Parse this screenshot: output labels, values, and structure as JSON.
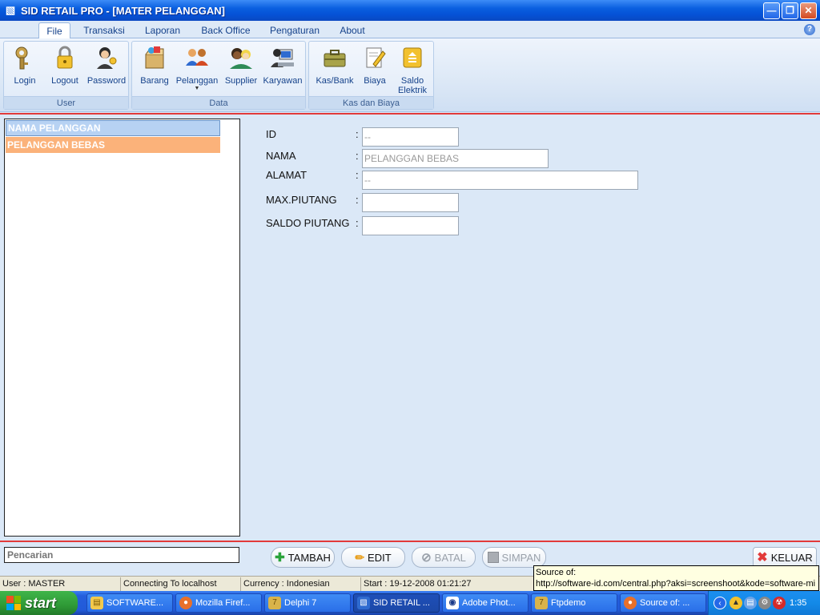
{
  "window": {
    "title": "SID RETAIL PRO - [MATER PELANGGAN]"
  },
  "ribbon": {
    "tabs": [
      "File",
      "Transaksi",
      "Laporan",
      "Back Office",
      "Pengaturan",
      "About"
    ],
    "active_tab": "File",
    "groups": {
      "user": {
        "label": "User",
        "buttons": [
          "Login",
          "Logout",
          "Password"
        ]
      },
      "data": {
        "label": "Data",
        "buttons": [
          "Barang",
          "Pelanggan",
          "Supplier",
          "Karyawan"
        ]
      },
      "kas": {
        "label": "Kas dan Biaya",
        "buttons": [
          "Kas/Bank",
          "Biaya",
          "Saldo",
          "Elektrik"
        ]
      }
    }
  },
  "list": {
    "header": "NAMA PELANGGAN",
    "rows": [
      "PELANGGAN BEBAS"
    ]
  },
  "form": {
    "fields": [
      {
        "label": "ID",
        "value": "--"
      },
      {
        "label": "NAMA",
        "value": "PELANGGAN BEBAS"
      },
      {
        "label": "ALAMAT",
        "value": "--"
      },
      {
        "label": "MAX.PIUTANG",
        "value": ""
      },
      {
        "label": "SALDO PIUTANG",
        "value": ""
      }
    ],
    "colon": ":"
  },
  "search": {
    "placeholder": "Pencarian"
  },
  "actions": {
    "tambah": "TAMBAH",
    "edit": "EDIT",
    "batal": "BATAL",
    "simpan": "SIMPAN",
    "keluar": "KELUAR"
  },
  "status": {
    "user": "User : MASTER",
    "connection": "Connecting To localhost",
    "currency": "Currency : Indonesian",
    "start": "Start  : 19-12-2008 01:21:27"
  },
  "tooltip": {
    "line1": "Source of:",
    "line2": "http://software-id.com/central.php?aksi=screenshoot&kode=software-mi"
  },
  "taskbar": {
    "start_label": "start",
    "tasks": [
      "SOFTWARE...",
      "Mozilla Firef...",
      "Delphi 7",
      "SID RETAIL ...",
      "Adobe Phot...",
      "Ftpdemo",
      "Source of: ..."
    ],
    "clock": "1:35"
  },
  "colors": {
    "accent_red": "#e23a3a",
    "list_selected": "#fbb27a",
    "list_header": "#b7d2f3"
  }
}
